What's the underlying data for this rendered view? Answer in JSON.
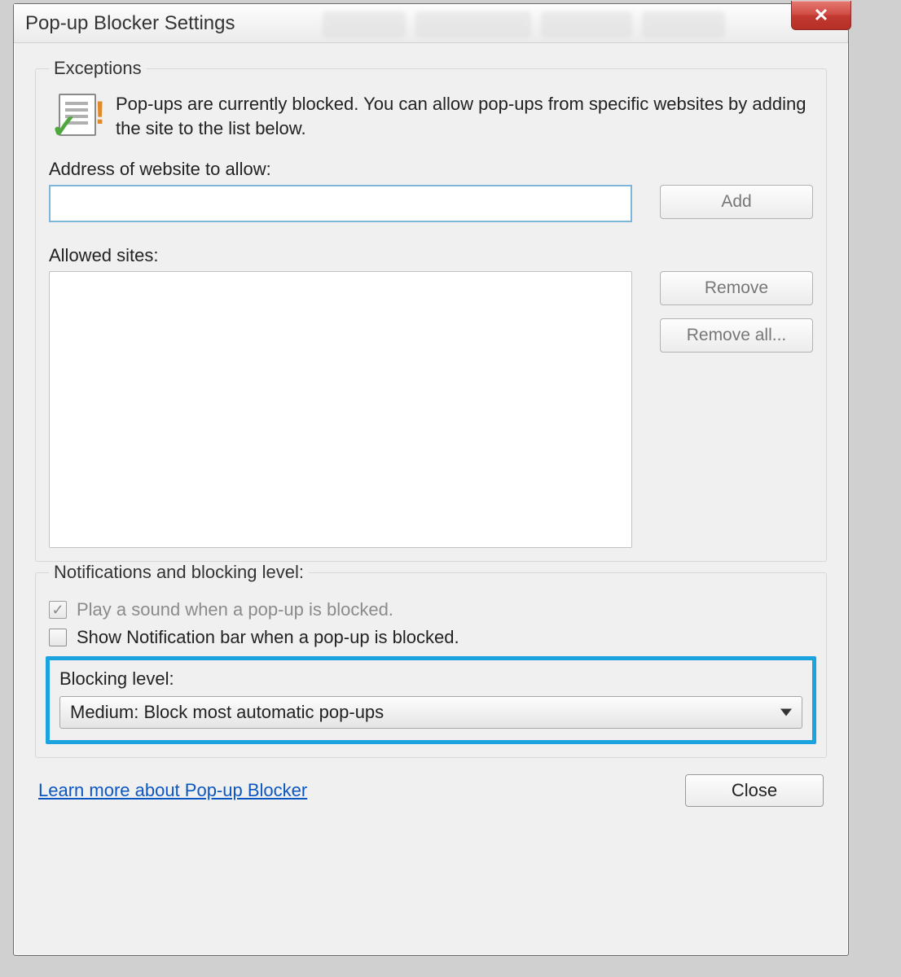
{
  "titlebar": {
    "title": "Pop-up Blocker Settings",
    "close_glyph": "✕"
  },
  "exceptions": {
    "legend": "Exceptions",
    "info_text": "Pop-ups are currently blocked.  You can allow pop-ups from specific websites by adding the site to the list below.",
    "address_label": "Address of website to allow:",
    "address_value": "",
    "add_label": "Add",
    "allowed_label": "Allowed sites:",
    "remove_label": "Remove",
    "remove_all_label": "Remove all..."
  },
  "notifications": {
    "legend": "Notifications and blocking level:",
    "play_sound_label": "Play a sound when a pop-up is blocked.",
    "play_sound_checked": true,
    "play_sound_enabled": false,
    "show_bar_label": "Show Notification bar when a pop-up is blocked.",
    "show_bar_checked": false,
    "blocking_level_label": "Blocking level:",
    "blocking_level_value": "Medium: Block most automatic pop-ups"
  },
  "footer": {
    "learn_more": "Learn more about Pop-up Blocker",
    "close": "Close"
  }
}
